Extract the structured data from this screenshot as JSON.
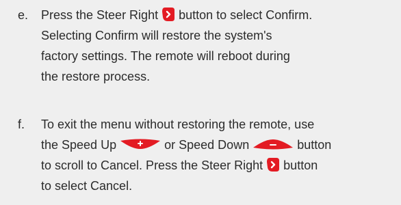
{
  "steps": [
    {
      "marker": "e.",
      "line1_a": "Press the Steer Right",
      "line1_b": "button to select Confirm.",
      "line2": "Selecting Confirm will restore the system's",
      "line3": "factory settings. The remote will reboot during",
      "line4": "the restore process."
    },
    {
      "marker": "f.",
      "line1": "To exit the menu without restoring the remote, use",
      "line2_a": "the Speed Up",
      "line2_b": "or Speed Down",
      "line2_c": "button",
      "line3_a": "to scroll to Cancel. Press the Steer Right",
      "line3_b": "button",
      "line4": "to select Cancel."
    }
  ],
  "icons": {
    "steer_right": "steer-right-icon",
    "speed_up": "speed-up-icon",
    "speed_down": "speed-down-icon"
  },
  "colors": {
    "background": "#efefef",
    "text": "#2b2b2b",
    "icon_red": "#e31b23",
    "icon_glyph": "#ffffff"
  }
}
